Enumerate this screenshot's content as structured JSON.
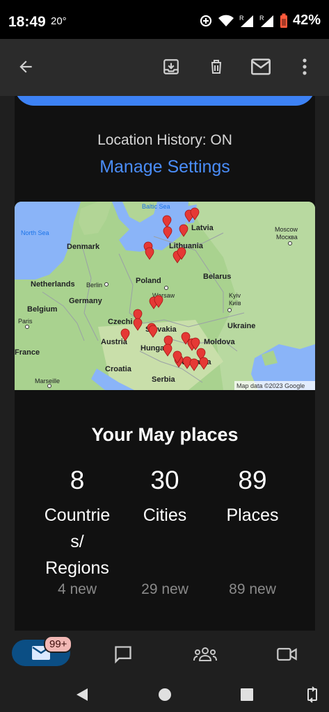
{
  "status_bar": {
    "time": "18:49",
    "temperature": "20°",
    "battery": "42%"
  },
  "app_bar": {
    "icons": [
      "back-arrow-icon",
      "archive-icon",
      "delete-icon",
      "mark-unread-icon",
      "more-icon"
    ]
  },
  "location": {
    "status": "Location History: ON",
    "manage_link": "Manage Settings"
  },
  "map": {
    "labels": {
      "baltic_sea": "Baltic Sea",
      "north_sea": "North Sea",
      "denmark": "Denmark",
      "latvia": "Latvia",
      "moscow": "Moscow",
      "moscow_ru": "Москва",
      "lithuania": "Lithuania",
      "netherlands": "Netherlands",
      "berlin": "Berlin",
      "poland": "Poland",
      "belarus": "Belarus",
      "belgium": "Belgium",
      "germany": "Germany",
      "warsaw": "Warsaw",
      "kyiv": "Kyiv",
      "kyiv_ua": "Київ",
      "paris": "Paris",
      "czechia": "Czechi",
      "slovakia": "Slovakia",
      "ukraine": "Ukraine",
      "france": "France",
      "austria": "Austria",
      "moldova": "Moldova",
      "hungary": "Hungary",
      "romania": "Romania",
      "croatia": "Croatia",
      "serbia": "Serbia",
      "marseille": "Marseille"
    },
    "attribution": "Map data ©2023 Google",
    "pin_color": "#e53935"
  },
  "summary": {
    "title": "Your May places",
    "stats": [
      {
        "value": "8",
        "label": "Countrie\ns/\nRegions",
        "new": "4 new"
      },
      {
        "value": "30",
        "label": "Cities",
        "new": "29 new"
      },
      {
        "value": "89",
        "label": "Places",
        "new": "89 new"
      }
    ]
  },
  "bottom_nav": {
    "badge": "99+",
    "items": [
      "mail-icon",
      "chat-icon",
      "spaces-icon",
      "meet-icon"
    ]
  },
  "colors": {
    "accent": "#3d82f5",
    "link": "#4a8df8"
  }
}
